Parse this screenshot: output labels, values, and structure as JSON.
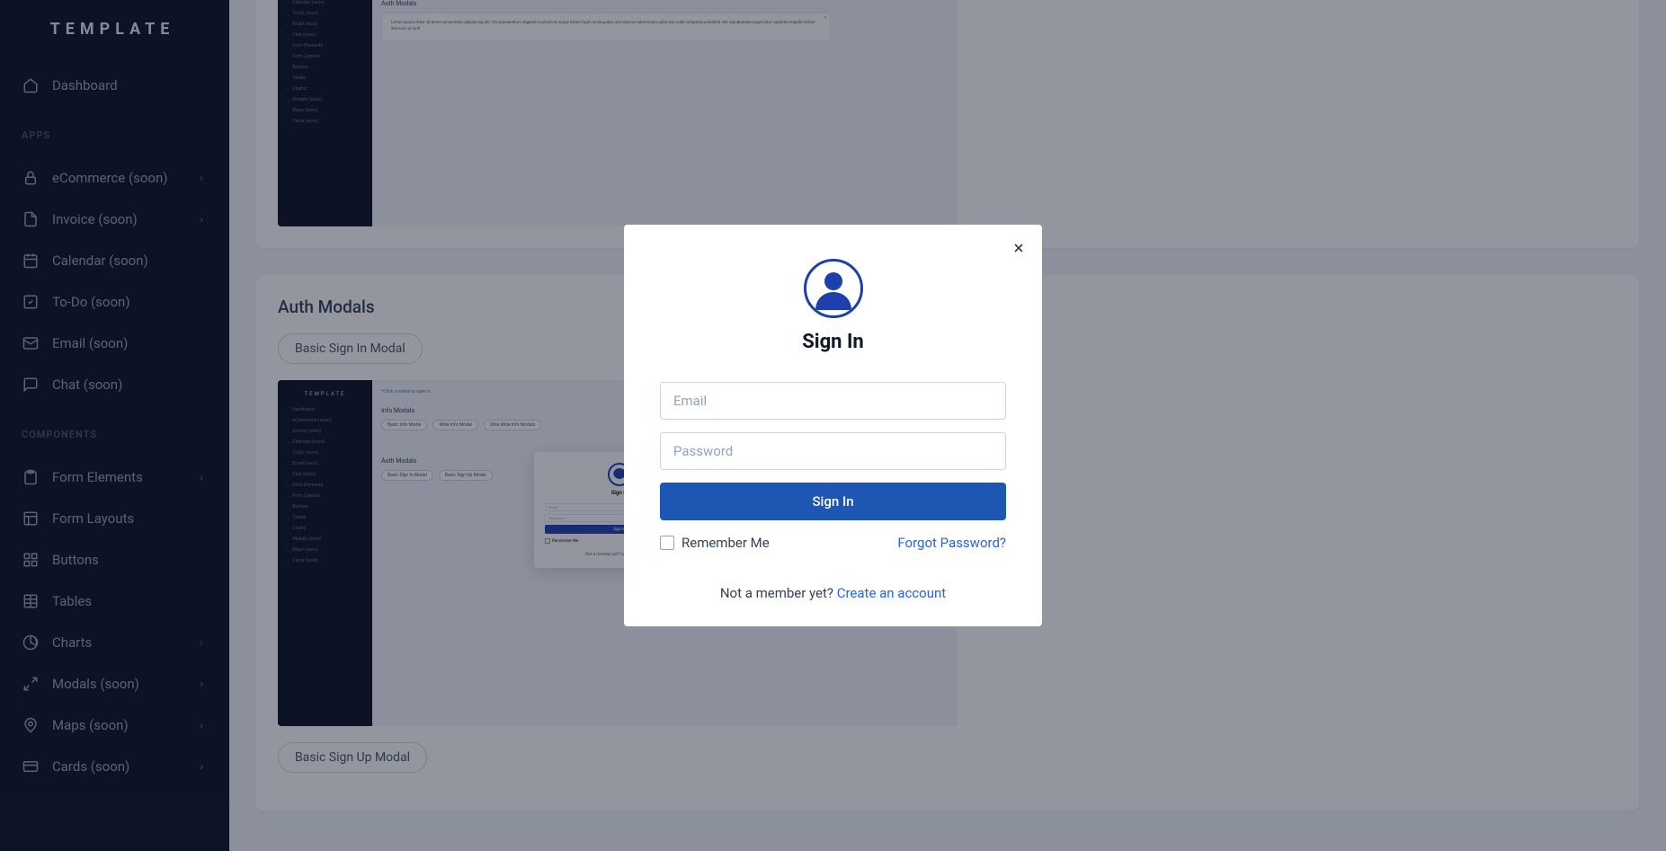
{
  "brand": "TEMPLATE",
  "nav": {
    "dashboard": "Dashboard",
    "sections": {
      "apps": "APPS",
      "components": "COMPONENTS"
    },
    "apps": [
      {
        "label": "eCommerce (soon)",
        "name": "sidebar-item-ecommerce",
        "icon": "lock-icon",
        "chevron": true
      },
      {
        "label": "Invoice (soon)",
        "name": "sidebar-item-invoice",
        "icon": "file-icon",
        "chevron": true
      },
      {
        "label": "Calendar (soon)",
        "name": "sidebar-item-calendar",
        "icon": "calendar-icon",
        "chevron": false
      },
      {
        "label": "To-Do (soon)",
        "name": "sidebar-item-todo",
        "icon": "check-icon",
        "chevron": false
      },
      {
        "label": "Email (soon)",
        "name": "sidebar-item-email",
        "icon": "mail-icon",
        "chevron": false
      },
      {
        "label": "Chat (soon)",
        "name": "sidebar-item-chat",
        "icon": "chat-icon",
        "chevron": false
      }
    ],
    "components": [
      {
        "label": "Form Elements",
        "name": "sidebar-item-form-elements",
        "icon": "clipboard-icon",
        "chevron": true
      },
      {
        "label": "Form Layouts",
        "name": "sidebar-item-form-layouts",
        "icon": "layout-icon",
        "chevron": false
      },
      {
        "label": "Buttons",
        "name": "sidebar-item-buttons",
        "icon": "grid-icon",
        "chevron": false
      },
      {
        "label": "Tables",
        "name": "sidebar-item-tables",
        "icon": "table-icon",
        "chevron": false
      },
      {
        "label": "Charts",
        "name": "sidebar-item-charts",
        "icon": "pie-icon",
        "chevron": true
      },
      {
        "label": "Modals (soon)",
        "name": "sidebar-item-modals",
        "icon": "expand-icon",
        "chevron": true
      },
      {
        "label": "Maps (soon)",
        "name": "sidebar-item-maps",
        "icon": "map-icon",
        "chevron": true
      },
      {
        "label": "Cards (soon)",
        "name": "sidebar-item-cards",
        "icon": "card-icon",
        "chevron": true
      }
    ]
  },
  "content": {
    "info_section": {
      "title": "Info Modals",
      "buttons": [
        "Basic Info Modal",
        "Wide Info Modal",
        "Ultra Wide Info Modals"
      ],
      "sub_title": "Auth Modals",
      "lorem": "Lorem ipsum dolor sit amet consectetur adipisicing elit. Hic praesentium eligendi nostrum et neque totam fugit consequatur, accusamus laboriosam optio non nulla voluptate prandenti iste repudiandae aspernatur sapiente impedit dolore dolorum, ut sint!"
    },
    "auth_section": {
      "title": "Auth Modals",
      "button1": "Basic Sign In Modal",
      "button2": "Basic Sign Up Modal",
      "preview_buttons": [
        "Basic Sign In Modal",
        "Basic Sign Up Modal"
      ],
      "preview_hint": "*Click a modal to open it"
    }
  },
  "modal": {
    "title": "Sign In",
    "email_placeholder": "Email",
    "password_placeholder": "Password",
    "submit": "Sign In",
    "remember": "Remember Me",
    "forgot": "Forgot Password?",
    "footer_text": "Not a member yet? ",
    "footer_link": "Create an account"
  },
  "preview_sidebar_items": [
    "Dashboard",
    "eCommerce (soon)",
    "Invoice (soon)",
    "Calendar (soon)",
    "To-Do (soon)",
    "Email (soon)",
    "Chat (soon)",
    "Form Elements",
    "Form Layouts",
    "Buttons",
    "Tables",
    "Charts",
    "Modals (soon)",
    "Maps (soon)",
    "Cards (soon)"
  ]
}
